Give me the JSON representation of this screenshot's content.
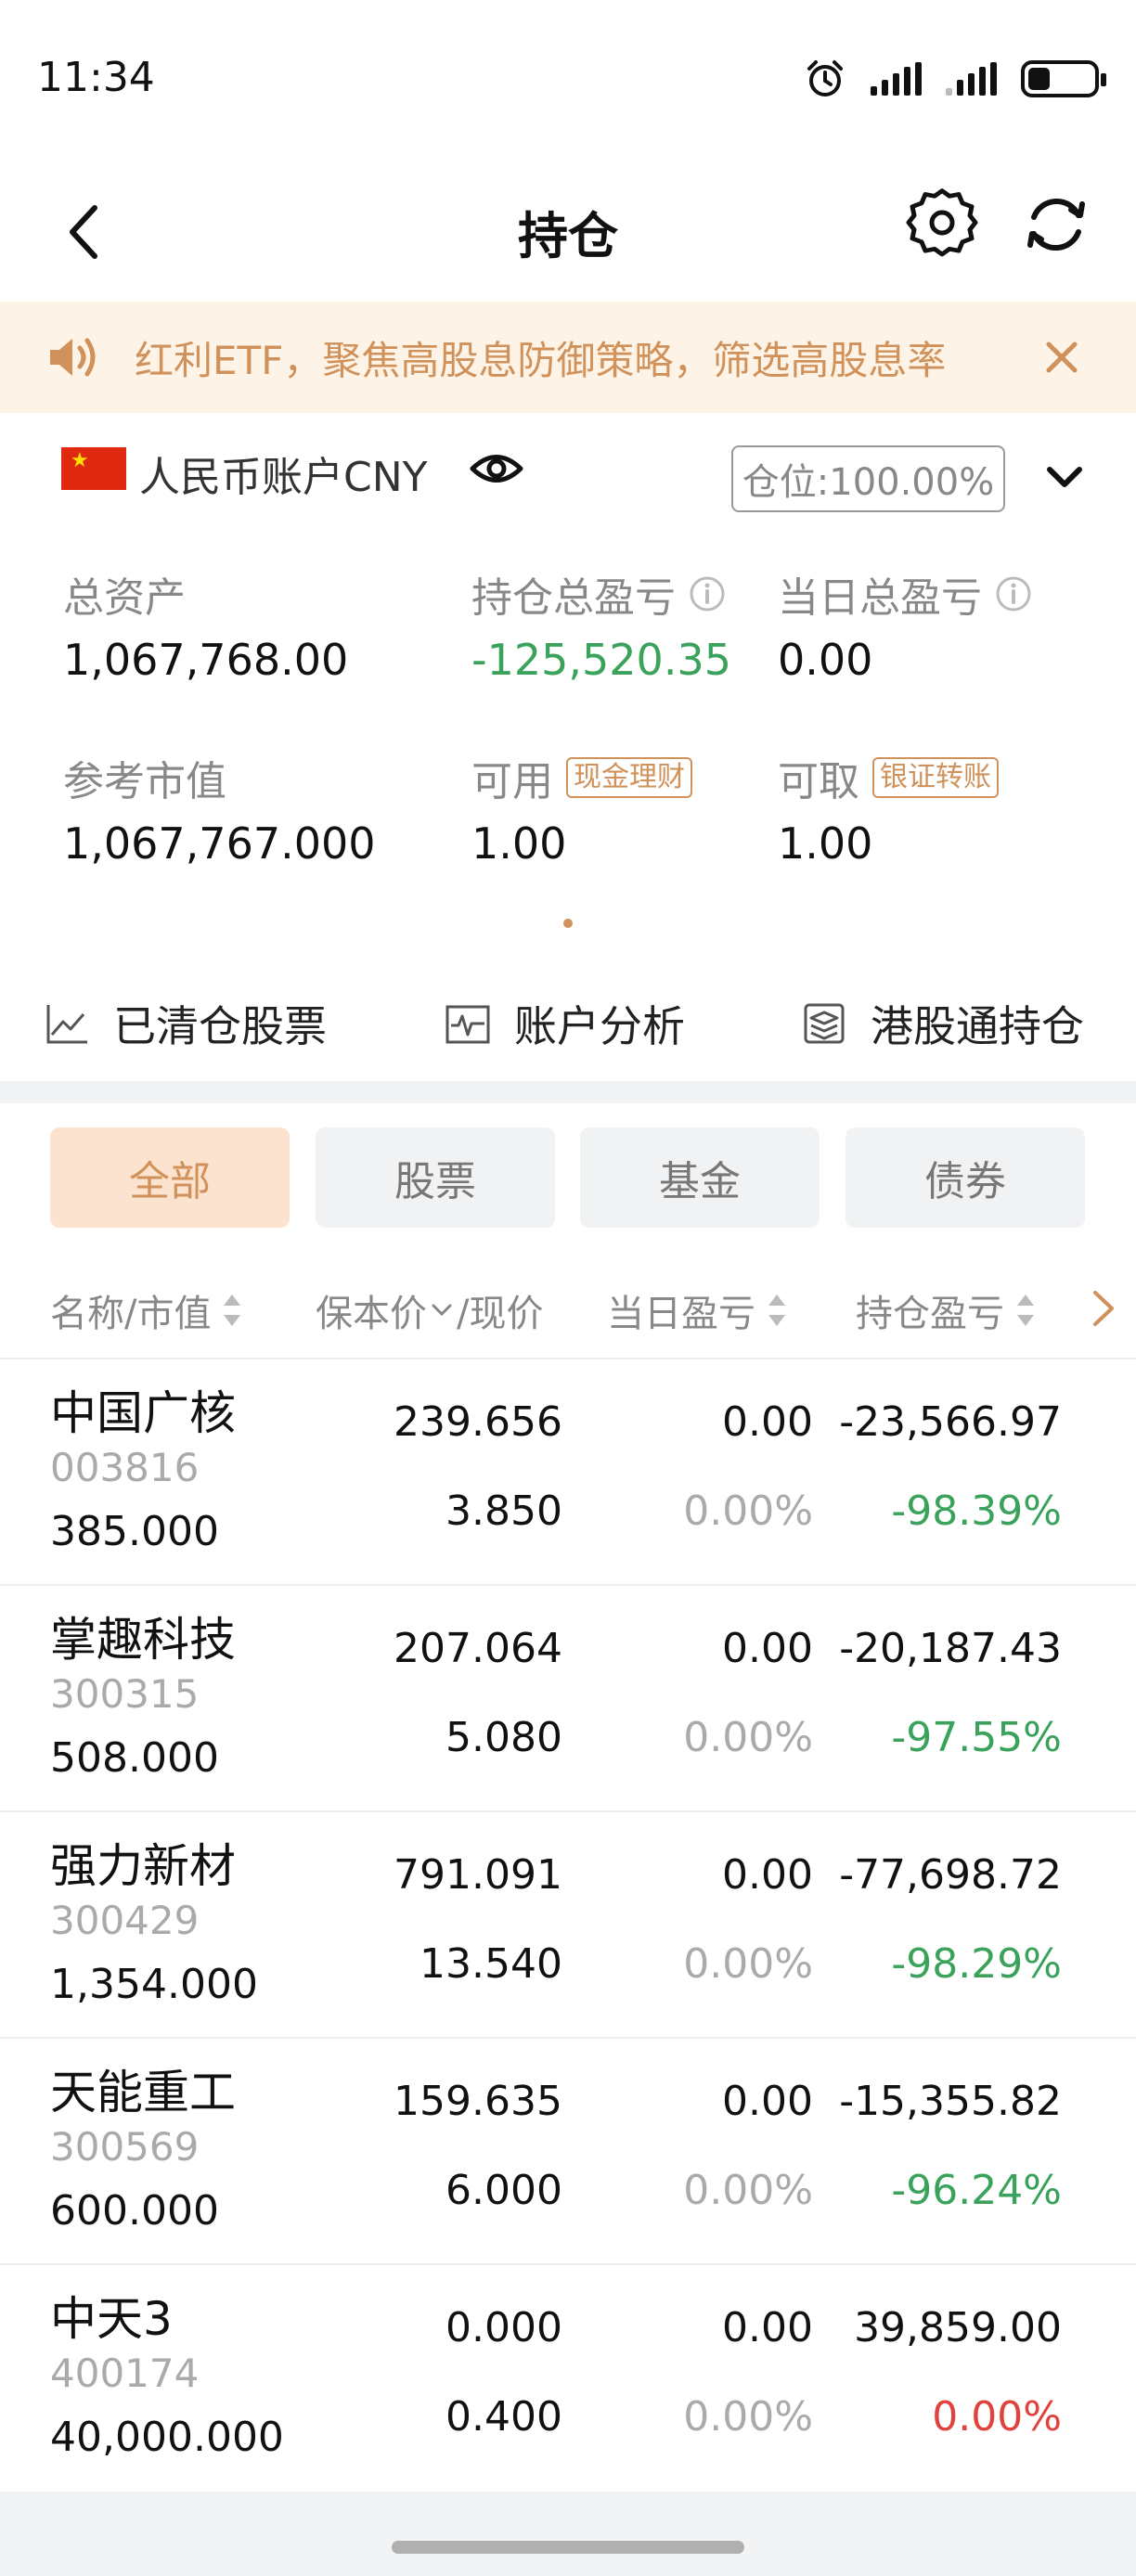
{
  "status": {
    "time": "11:34"
  },
  "nav": {
    "title": "持仓"
  },
  "banner": {
    "text": "红利ETF，聚焦高股息防御策略，筛选高股息率"
  },
  "account": {
    "name": "人民币账户CNY",
    "position_label": "仓位:100.00%",
    "metrics": {
      "total_assets": {
        "label": "总资产",
        "value": "1,067,768.00"
      },
      "holding_pl": {
        "label": "持仓总盈亏",
        "value": "-125,520.35"
      },
      "day_pl": {
        "label": "当日总盈亏",
        "value": "0.00"
      },
      "market_value": {
        "label": "参考市值",
        "value": "1,067,767.000"
      },
      "available": {
        "label": "可用",
        "tag": "现金理财",
        "value": "1.00"
      },
      "withdrawable": {
        "label": "可取",
        "tag": "银证转账",
        "value": "1.00"
      }
    }
  },
  "shortcuts": {
    "cleared": "已清仓股票",
    "analysis": "账户分析",
    "hk_connect": "港股通持仓"
  },
  "tabs": [
    "全部",
    "股票",
    "基金",
    "债券"
  ],
  "table": {
    "headers": {
      "name": "名称/市值",
      "cost": "保本价",
      "price": "/现价",
      "day_pl": "当日盈亏",
      "pl": "持仓盈亏"
    },
    "rows": [
      {
        "name": "中国广核",
        "code": "003816",
        "market_value": "385.000",
        "cost": "239.656",
        "price": "3.850",
        "day_pl": "0.00",
        "day_pct": "0.00%",
        "pl": "-23,566.97",
        "pl_pct": "-98.39%"
      },
      {
        "name": "掌趣科技",
        "code": "300315",
        "market_value": "508.000",
        "cost": "207.064",
        "price": "5.080",
        "day_pl": "0.00",
        "day_pct": "0.00%",
        "pl": "-20,187.43",
        "pl_pct": "-97.55%"
      },
      {
        "name": "强力新材",
        "code": "300429",
        "market_value": "1,354.000",
        "cost": "791.091",
        "price": "13.540",
        "day_pl": "0.00",
        "day_pct": "0.00%",
        "pl": "-77,698.72",
        "pl_pct": "-98.29%"
      },
      {
        "name": "天能重工",
        "code": "300569",
        "market_value": "600.000",
        "cost": "159.635",
        "price": "6.000",
        "day_pl": "0.00",
        "day_pct": "0.00%",
        "pl": "-15,355.82",
        "pl_pct": "-96.24%"
      },
      {
        "name": "中天3",
        "code": "400174",
        "market_value": "40,000.000",
        "cost": "0.000",
        "price": "0.400",
        "day_pl": "0.00",
        "day_pct": "0.00%",
        "pl": "39,859.00",
        "pl_pct": "0.00%"
      }
    ]
  },
  "colors": {
    "accent": "#d0925a",
    "loss": "#3aa25a",
    "gain": "#e0433b",
    "banner_bg": "#fdf3e7"
  }
}
